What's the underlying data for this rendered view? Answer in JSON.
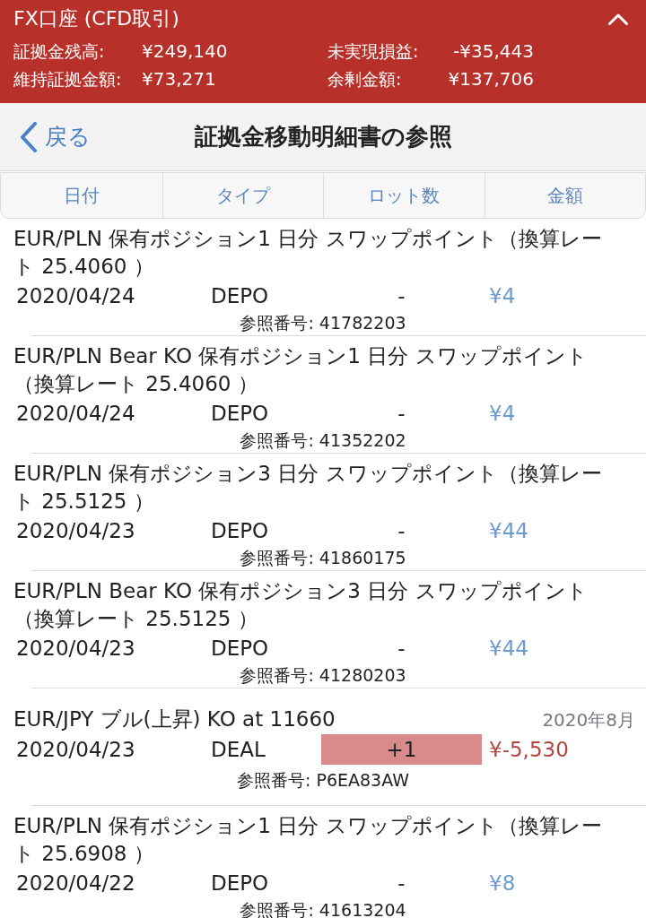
{
  "account_header": {
    "title": "FX口座 (CFD取引)",
    "expanded": true,
    "summary": [
      {
        "label": "証拠金残高:",
        "value": "¥249,140"
      },
      {
        "label": "未実現損益:",
        "value": "-¥35,443"
      },
      {
        "label": "維持証拠金額:",
        "value": "¥73,271"
      },
      {
        "label": "余剰金額:",
        "value": "¥137,706"
      }
    ]
  },
  "nav_bar": {
    "back_label": "戻る",
    "title": "証拠金移動明細書の参照"
  },
  "columns": [
    "日付",
    "タイプ",
    "ロット数",
    "金額"
  ],
  "rows": [
    {
      "kind": "swap",
      "description": "EUR/PLN 保有ポジション1 日分 スワップポイント（換算レート 25.4060 ）",
      "date": "2020/04/24",
      "type": "DEPO",
      "lots": "-",
      "amount": "¥4",
      "reference": "参照番号: 41782203"
    },
    {
      "kind": "swap",
      "description": "EUR/PLN Bear KO 保有ポジション1 日分 スワップポイント（換算レート 25.4060 ）",
      "date": "2020/04/24",
      "type": "DEPO",
      "lots": "-",
      "amount": "¥4",
      "reference": "参照番号: 41352202"
    },
    {
      "kind": "swap",
      "description": "EUR/PLN 保有ポジション3 日分 スワップポイント（換算レート 25.5125 ）",
      "date": "2020/04/23",
      "type": "DEPO",
      "lots": "-",
      "amount": "¥44",
      "reference": "参照番号: 41860175"
    },
    {
      "kind": "swap",
      "description": "EUR/PLN Bear KO 保有ポジション3 日分 スワップポイント（換算レート 25.5125 ）",
      "date": "2020/04/23",
      "type": "DEPO",
      "lots": "-",
      "amount": "¥44",
      "reference": "参照番号: 41280203"
    },
    {
      "kind": "deal",
      "description": "EUR/JPY ブル(上昇) KO at 11660",
      "note": "2020年8月",
      "date": "2020/04/23",
      "type": "DEAL",
      "lots": "+1",
      "amount": "¥-5,530",
      "reference": "参照番号: P6EA83AW"
    },
    {
      "kind": "swap",
      "description": "EUR/PLN 保有ポジション1 日分 スワップポイント（換算レート 25.6908 ）",
      "date": "2020/04/22",
      "type": "DEPO",
      "lots": "-",
      "amount": "¥8",
      "reference": "参照番号: 41613204"
    }
  ]
}
